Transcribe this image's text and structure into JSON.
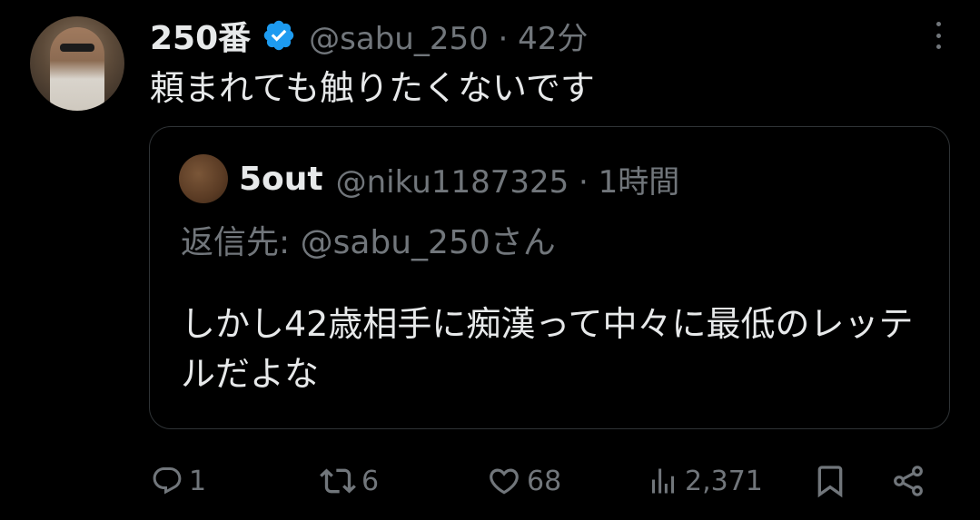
{
  "tweet": {
    "display_name": "250番",
    "handle_time": "@sabu_250 · 42分",
    "text": "頼まれても触りたくないです"
  },
  "quoted": {
    "display_name": "5out",
    "handle_time": "@niku1187325 · 1時間",
    "reply_to": "返信先: @sabu_250さん",
    "text": "しかし42歳相手に痴漢って中々に最低のレッテルだよな"
  },
  "actions": {
    "reply_count": "1",
    "retweet_count": "6",
    "like_count": "68",
    "view_count": "2,371"
  },
  "icons": {
    "verified": "verified-badge-icon",
    "more": "more-options-icon",
    "reply": "reply-icon",
    "retweet": "retweet-icon",
    "like": "heart-icon",
    "views": "views-chart-icon",
    "bookmark": "bookmark-icon",
    "share": "share-icon"
  },
  "colors": {
    "background": "#000000",
    "text_primary": "#e7e9ea",
    "text_secondary": "#71767b",
    "verified_blue": "#1d9bf0",
    "border": "#2f3336"
  }
}
